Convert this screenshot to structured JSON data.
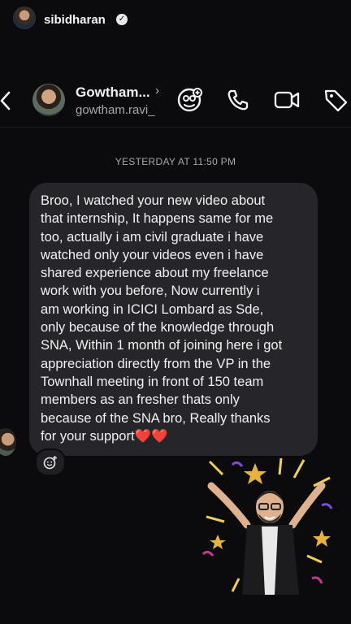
{
  "profile": {
    "username": "sibidharan",
    "verified_icon": "verified-badge-icon"
  },
  "chat_header": {
    "back_icon": "chevron-left-icon",
    "contact_name": "Gowtham...",
    "name_chevron": "›",
    "contact_handle": "gowtham.ravi_",
    "actions": [
      "add-people-icon",
      "phone-icon",
      "video-camera-icon",
      "tag-icon"
    ]
  },
  "timestamp": "YESTERDAY AT 11:50 PM",
  "message": {
    "lines": [
      "Broo, I watched your new video about",
      "that internship, It happens same for me",
      "too, actually i am civil graduate i have",
      "watched only your videos even i have",
      "shared experience about my freelance",
      "work with you before, Now currently i",
      "am working in ICICI Lombard as Sde,",
      "only because of the knowledge through",
      "SNA, Within 1 month of joining here i got",
      "appreciation directly from the VP in the",
      "Townhall meeting in front of 150 team",
      "members as an fresher thats only",
      "because of the SNA bro, Really thanks",
      "for your support❤️❤️"
    ]
  },
  "reaction_icon": "add-reaction-icon",
  "sticker": "celebration-sticker"
}
